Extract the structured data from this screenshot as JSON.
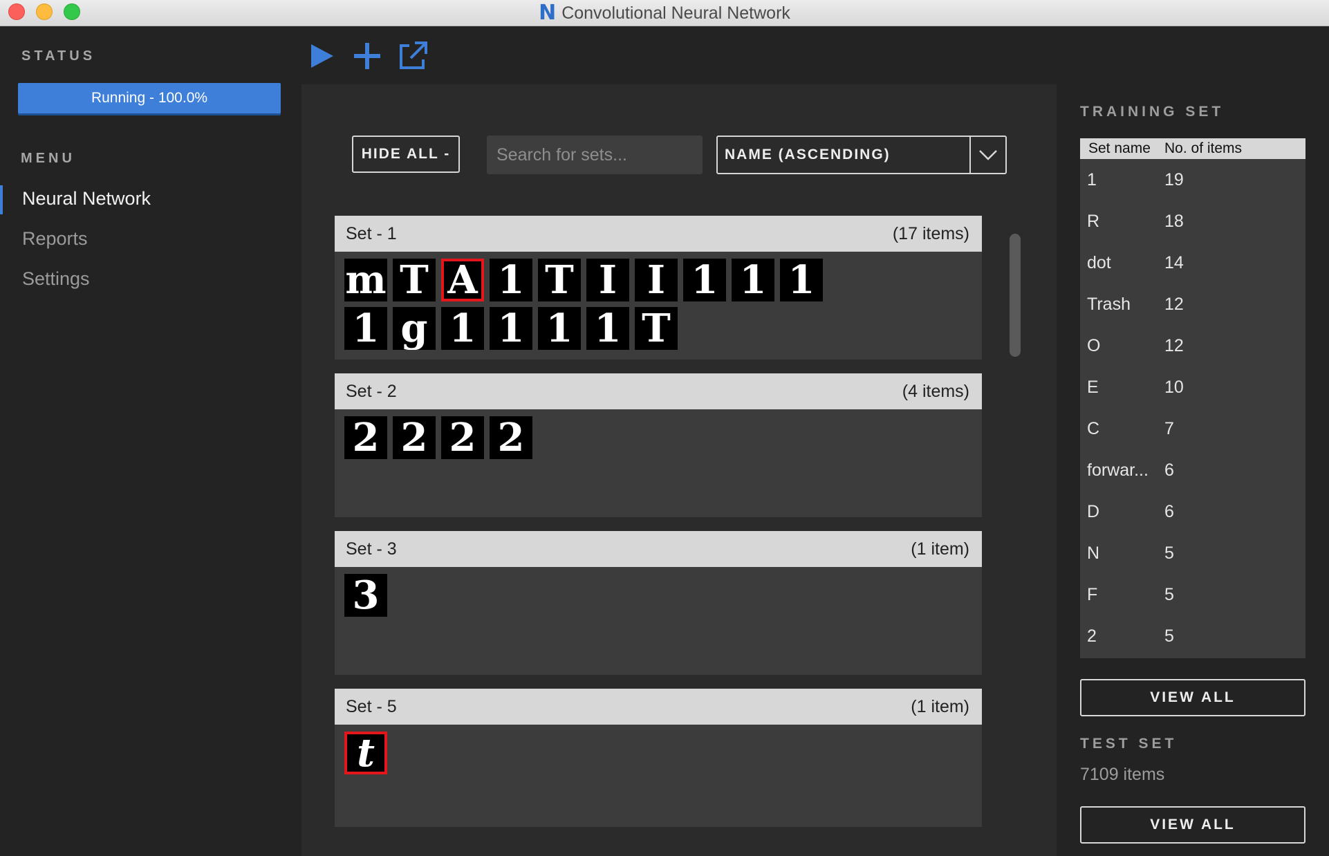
{
  "window": {
    "title": "Convolutional Neural Network",
    "logo": "N"
  },
  "sidebar": {
    "status_label": "STATUS",
    "status_text": "Running - 100.0%",
    "status_progress": 100.0,
    "menu_label": "MENU",
    "menu_items": [
      {
        "label": "Neural Network",
        "active": true
      },
      {
        "label": "Reports",
        "active": false
      },
      {
        "label": "Settings",
        "active": false
      }
    ]
  },
  "toolbar": {
    "icons": [
      "play-icon",
      "plus-icon",
      "external-link-icon"
    ],
    "accent": "#3d7fd9"
  },
  "controls": {
    "hide_all": "HIDE ALL -",
    "search_placeholder": "Search for sets...",
    "sort_value": "NAME (ASCENDING)"
  },
  "sets": [
    {
      "name": "Set - 1",
      "count": "(17 items)",
      "items": [
        "m",
        "T",
        "A",
        "1",
        "T",
        "I",
        "I",
        "1",
        "1",
        "1",
        "1",
        "g",
        "1",
        "1",
        "1",
        "1",
        "T"
      ],
      "selected": [
        2
      ]
    },
    {
      "name": "Set - 2",
      "count": "(4 items)",
      "items": [
        "2",
        "2",
        "2",
        "2"
      ],
      "selected": []
    },
    {
      "name": "Set - 3",
      "count": "(1 item)",
      "items": [
        "3"
      ],
      "selected": []
    },
    {
      "name": "Set - 5",
      "count": "(1 item)",
      "items": [
        "t"
      ],
      "selected": [
        0
      ]
    }
  ],
  "training_set": {
    "label": "TRAINING SET",
    "col_name": "Set name",
    "col_count": "No. of items",
    "rows": [
      {
        "name": "1",
        "count": "19"
      },
      {
        "name": "R",
        "count": "18"
      },
      {
        "name": "dot",
        "count": "14"
      },
      {
        "name": "Trash",
        "count": "12"
      },
      {
        "name": "O",
        "count": "12"
      },
      {
        "name": "E",
        "count": "10"
      },
      {
        "name": "C",
        "count": "7"
      },
      {
        "name": "forwar...",
        "count": "6"
      },
      {
        "name": "D",
        "count": "6"
      },
      {
        "name": "N",
        "count": "5"
      },
      {
        "name": "F",
        "count": "5"
      },
      {
        "name": "2",
        "count": "5"
      }
    ],
    "view_all": "VIEW ALL"
  },
  "test_set": {
    "label": "TEST SET",
    "count_text": "7109 items",
    "view_all": "VIEW ALL"
  }
}
